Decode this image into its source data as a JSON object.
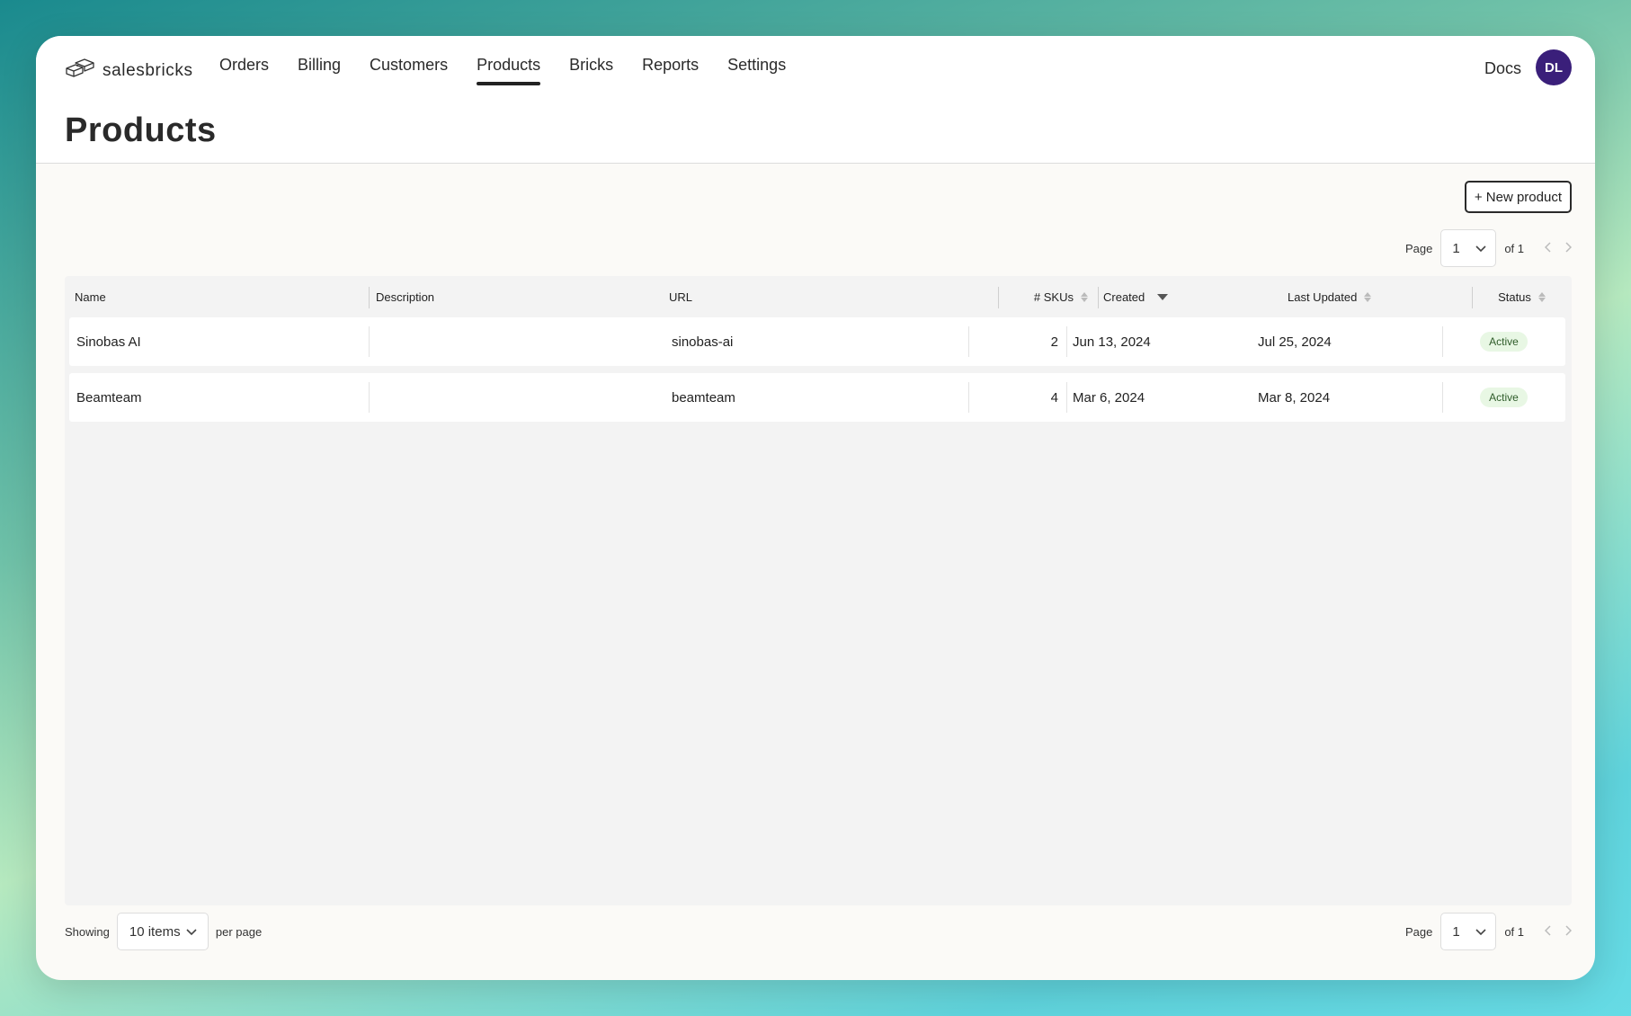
{
  "app": {
    "brand": "salesbricks",
    "nav": [
      "Orders",
      "Billing",
      "Customers",
      "Products",
      "Bricks",
      "Reports",
      "Settings"
    ],
    "active_nav": "Products",
    "docs_label": "Docs",
    "avatar_initials": "DL",
    "avatar_color": "#3a1f7a"
  },
  "page": {
    "title": "Products",
    "new_button_label": "+ New product"
  },
  "pagination": {
    "page_label": "Page",
    "current_page": "1",
    "of_label": "of 1",
    "showing_label": "Showing",
    "per_page_value": "10 items",
    "per_page_label": "per page"
  },
  "table": {
    "columns": [
      "Name",
      "Description",
      "URL",
      "# SKUs",
      "Created",
      "Last Updated",
      "Status"
    ],
    "rows": [
      {
        "name": "Sinobas AI",
        "description": "",
        "url": "sinobas-ai",
        "skus": "2",
        "created": "Jun 13, 2024",
        "updated": "Jul 25, 2024",
        "status": "Active"
      },
      {
        "name": "Beamteam",
        "description": "",
        "url": "beamteam",
        "skus": "4",
        "created": "Mar 6, 2024",
        "updated": "Mar 8, 2024",
        "status": "Active"
      }
    ]
  }
}
